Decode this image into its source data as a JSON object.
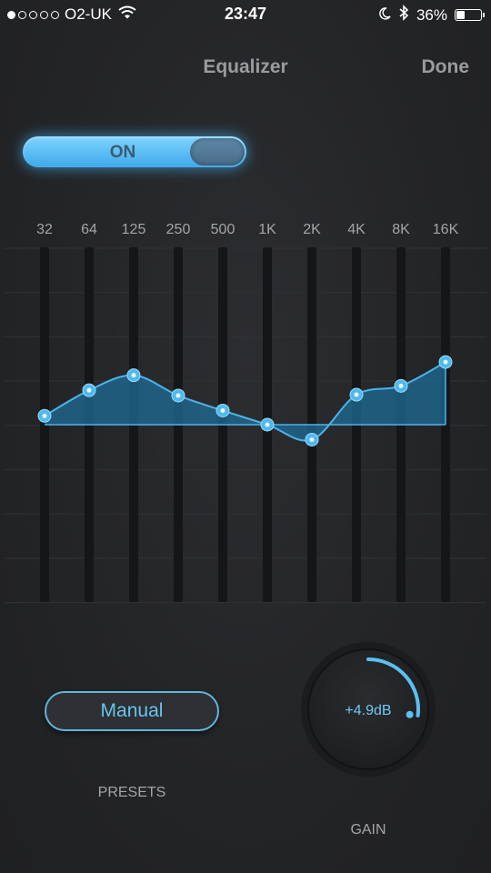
{
  "status_bar": {
    "carrier": "O2-UK",
    "signal_bars_filled": 1,
    "signal_bars_total": 5,
    "time": "23:47",
    "battery_text": "36%",
    "battery_level": 0.36,
    "icons": [
      "wifi-icon",
      "moon-icon",
      "bluetooth-icon",
      "battery-icon"
    ]
  },
  "header": {
    "title": "Equalizer",
    "done_label": "Done"
  },
  "toggle": {
    "label": "ON",
    "state": true
  },
  "eq": {
    "bands": [
      "32",
      "64",
      "125",
      "250",
      "500",
      "1K",
      "2K",
      "4K",
      "8K",
      "16K"
    ],
    "levels": [
      0.1,
      0.39,
      0.56,
      0.33,
      0.16,
      0.0,
      -0.17,
      0.34,
      0.44,
      0.71
    ]
  },
  "presets": {
    "selected": "Manual",
    "label": "PRESETS"
  },
  "gain": {
    "value_text": "+4.9dB",
    "fraction": 0.27,
    "label": "GAIN"
  },
  "colors": {
    "accent": "#4db8f0",
    "text_muted": "#a4a5a8",
    "background": "#252628"
  }
}
